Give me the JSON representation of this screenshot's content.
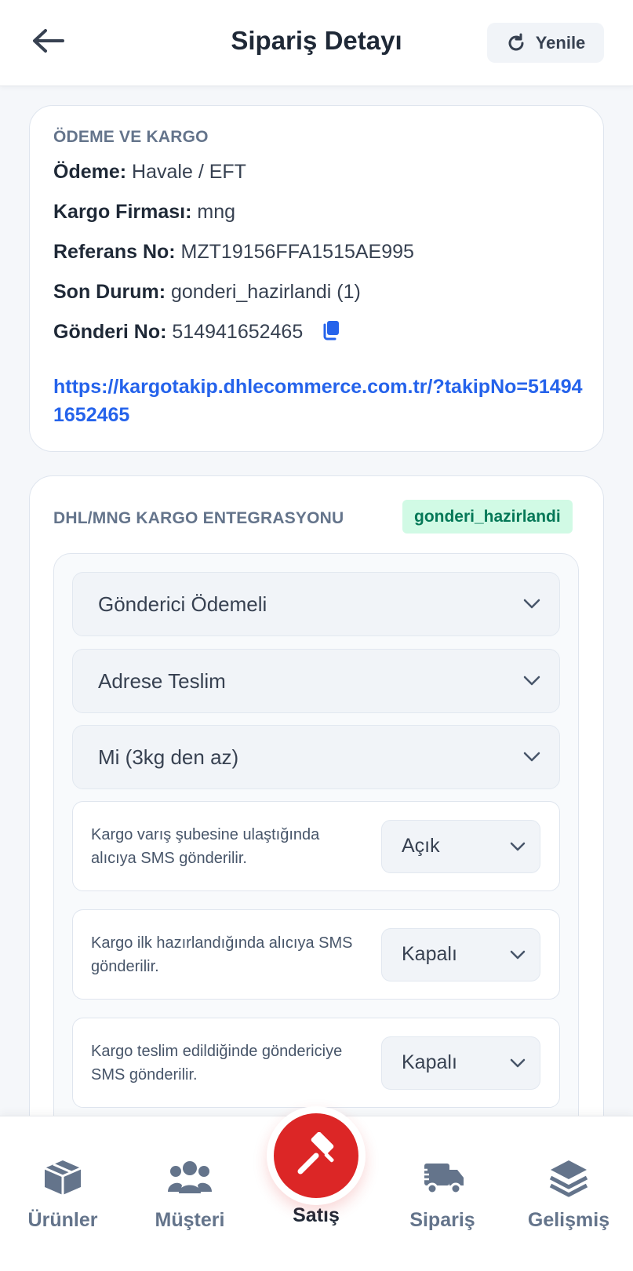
{
  "header": {
    "title": "Sipariş Detayı",
    "refresh_label": "Yenile",
    "back_icon": "arrow-left-icon",
    "refresh_icon": "rotate-cw-icon"
  },
  "payment_card": {
    "section_title": "ÖDEME VE KARGO",
    "rows": [
      {
        "label": "Ödeme:",
        "value": "Havale / EFT"
      },
      {
        "label": "Kargo Firması:",
        "value": "mng"
      },
      {
        "label": "Referans No:",
        "value": "MZT19156FFA1515AE995"
      },
      {
        "label": "Son Durum:",
        "value": "gonderi_hazirlandi (1)"
      },
      {
        "label": "Gönderi No:",
        "value": "514941652465"
      }
    ],
    "tracking_link": "https://kargotakip.dhlecommerce.com.tr/?takipNo=514941652465"
  },
  "integration_card": {
    "section_title": "DHL/MNG KARGO ENTEGRASYONU",
    "status_badge": "gonderi_hazirlandi",
    "selects": [
      {
        "value": "Gönderici Ödemeli"
      },
      {
        "value": "Adrese Teslim"
      },
      {
        "value": "Mi (3kg den az)"
      }
    ],
    "sms_options": [
      {
        "text": "Kargo varış şubesine ulaştığında alıcıya SMS gönderilir.",
        "value": "Açık"
      },
      {
        "text": "Kargo ilk hazırlandığında alıcıya SMS gönderilir.",
        "value": "Kapalı"
      },
      {
        "text": "Kargo teslim edildiğinde göndericiye SMS gönderilir.",
        "value": "Kapalı"
      }
    ]
  },
  "bottom_nav": {
    "items": [
      {
        "label": "Ürünler",
        "icon": "box-icon"
      },
      {
        "label": "Müşteri",
        "icon": "users-icon"
      },
      {
        "label": "Satış",
        "icon": "gavel-icon"
      },
      {
        "label": "Sipariş",
        "icon": "truck-icon"
      },
      {
        "label": "Gelişmiş",
        "icon": "layers-icon"
      }
    ],
    "active_index": 2
  },
  "colors": {
    "accent_blue": "#2563eb",
    "fab_red": "#dc2626",
    "badge_bg": "#d1fae5",
    "badge_text": "#047857"
  }
}
